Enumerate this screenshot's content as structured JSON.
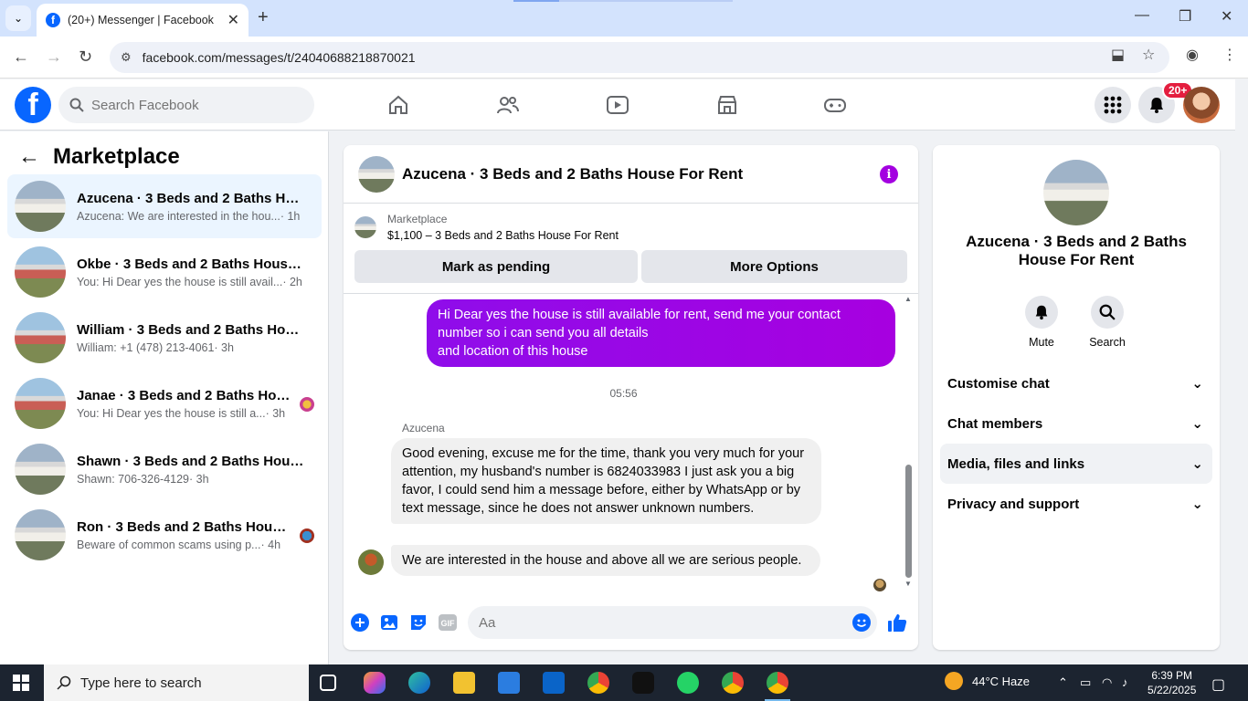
{
  "browser": {
    "tab_title": "(20+) Messenger | Facebook",
    "url": "facebook.com/messages/t/24040688218870021"
  },
  "header": {
    "search_placeholder": "Search Facebook",
    "notification_count": "20+"
  },
  "sidebar": {
    "title": "Marketplace",
    "conversations": [
      {
        "title": "Azucena · 3 Beds and 2 Baths Hou...",
        "preview": "Azucena: We are interested in the hou...",
        "time": "· 1h",
        "active": true,
        "thumb": "grey"
      },
      {
        "title": "Okbe · 3 Beds and 2 Baths House ...",
        "preview": "You: Hi Dear yes the house is still avail...",
        "time": "· 2h",
        "thumb": "red"
      },
      {
        "title": "William · 3 Beds and 2 Baths Hous...",
        "preview": "William: +1 (478) 213-4061",
        "time": "· 3h",
        "thumb": "red"
      },
      {
        "title": "Janae · 3 Beds and 2 Baths Hous...",
        "preview": "You: Hi Dear yes the house is still a...",
        "time": "· 3h",
        "thumb": "red"
      },
      {
        "title": "Shawn · 3 Beds and 2 Baths House...",
        "preview": "Shawn: 706-326-4129",
        "time": "· 3h",
        "thumb": "grey"
      },
      {
        "title": "Ron · 3 Beds and 2 Baths House ...",
        "preview": "Beware of common scams using p...",
        "time": "· 4h",
        "thumb": "grey"
      }
    ]
  },
  "chat": {
    "title": "Azucena · 3 Beds and 2 Baths House For Rent",
    "listing_label": "Marketplace",
    "listing_price": "$1,100 – 3 Beds and 2 Baths House For Rent",
    "mark_pending_label": "Mark as pending",
    "more_options_label": "More Options",
    "outgoing_message": "Hi Dear yes the house is still available for rent, send me your contact number so i can send you all details\nand location of this house",
    "timestamp": "05:56",
    "sender_name": "Azucena",
    "incoming_message_1": "Good evening, excuse me for the time, thank you very much for your attention, my husband's number is 6824033983 I just ask you a big favor, I could send him a message before, either by WhatsApp or by text message, since he does not answer unknown numbers.",
    "incoming_message_2": "We are interested in the house and above all we are serious people.",
    "input_placeholder": "Aa",
    "gif_label": "GIF"
  },
  "details": {
    "title": "Azucena · 3 Beds and 2 Baths House For Rent",
    "mute_label": "Mute",
    "search_label": "Search",
    "rows": [
      "Customise chat",
      "Chat members",
      "Media, files and links",
      "Privacy and support"
    ]
  },
  "taskbar": {
    "search_placeholder": "Type here to search",
    "weather": "44°C  Haze",
    "time": "6:39 PM",
    "date": "5/22/2025"
  },
  "colors": {
    "fb_blue": "#0866ff",
    "messenger_purple": "#a200e8",
    "badge_red": "#e41e3f"
  }
}
